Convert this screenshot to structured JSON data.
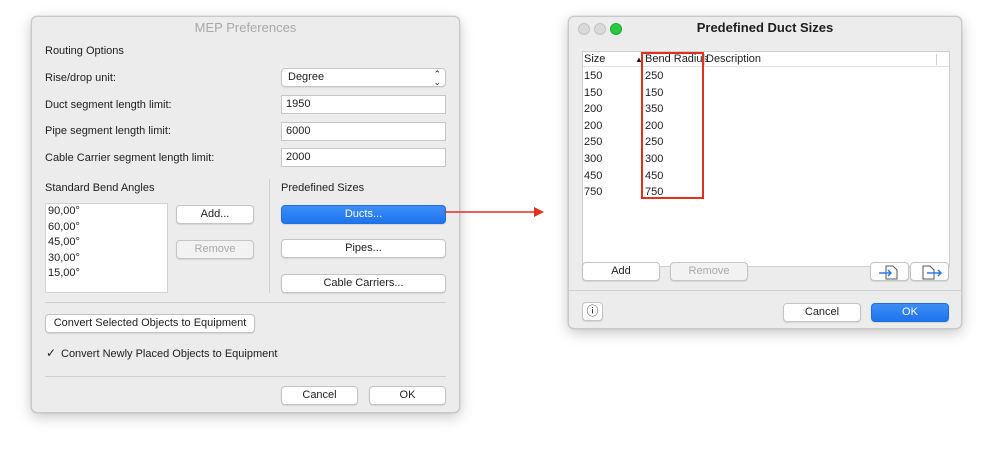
{
  "mep": {
    "title": "MEP Preferences",
    "routing_options": "Routing Options",
    "rise_drop_label": "Rise/drop unit:",
    "rise_drop_value": "Degree",
    "duct_limit_label": "Duct segment length limit:",
    "duct_limit_value": "1950",
    "pipe_limit_label": "Pipe segment length limit:",
    "pipe_limit_value": "6000",
    "cable_limit_label": "Cable Carrier segment length limit:",
    "cable_limit_value": "2000",
    "bend_angles_label": "Standard Bend Angles",
    "bend_angles": [
      "90,00°",
      "60,00°",
      "45,00°",
      "30,00°",
      "15,00°"
    ],
    "add_label": "Add...",
    "remove_label": "Remove",
    "predefined_sizes_label": "Predefined Sizes",
    "ducts_label": "Ducts...",
    "pipes_label": "Pipes...",
    "cable_carriers_label": "Cable Carriers...",
    "convert_selected_label": "Convert Selected Objects to Equipment",
    "convert_new_checked": true,
    "convert_new_label": "Convert Newly Placed Objects to Equipment",
    "cancel_label": "Cancel",
    "ok_label": "OK"
  },
  "duct": {
    "title": "Predefined Duct Sizes",
    "columns": [
      "Size",
      "Bend Radius",
      "Description"
    ],
    "sort_indicator": "▲",
    "rows": [
      {
        "size": "150",
        "radius": "250",
        "desc": ""
      },
      {
        "size": "150",
        "radius": "150",
        "desc": ""
      },
      {
        "size": "200",
        "radius": "350",
        "desc": ""
      },
      {
        "size": "200",
        "radius": "200",
        "desc": ""
      },
      {
        "size": "250",
        "radius": "250",
        "desc": ""
      },
      {
        "size": "300",
        "radius": "300",
        "desc": ""
      },
      {
        "size": "450",
        "radius": "450",
        "desc": ""
      },
      {
        "size": "750",
        "radius": "750",
        "desc": ""
      }
    ],
    "add_label": "Add",
    "remove_label": "Remove",
    "cancel_label": "Cancel",
    "ok_label": "OK",
    "info_icon": "ⓘ"
  },
  "colors": {
    "accent": "#1f73ee",
    "highlight": "#e0301e",
    "traffic_close": "#d9d9d9",
    "traffic_min": "#d9d9d9",
    "traffic_zoom": "#28c840"
  }
}
